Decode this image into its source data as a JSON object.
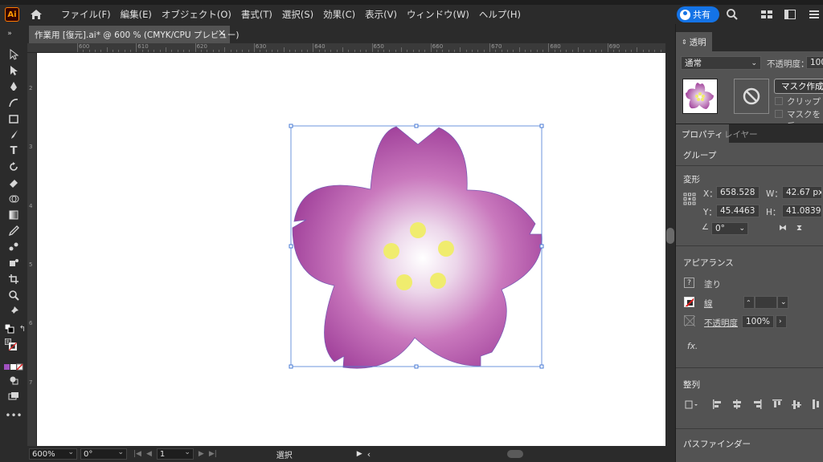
{
  "menu": {
    "app_logo": "Ai",
    "items": [
      "ファイル(F)",
      "編集(E)",
      "オブジェクト(O)",
      "書式(T)",
      "選択(S)",
      "効果(C)",
      "表示(V)",
      "ウィンドウ(W)",
      "ヘルプ(H)"
    ],
    "share_label": "共有"
  },
  "document": {
    "tab_title": "作業用 [復元].ai* @ 600 % (CMYK/CPU プレビュー)",
    "close": "×"
  },
  "ruler": {
    "h_ticks": [
      "600",
      "610",
      "620",
      "630",
      "640",
      "650",
      "660",
      "670",
      "680",
      "690"
    ],
    "v_ticks": [
      "2",
      "3",
      "4",
      "5",
      "6",
      "7"
    ]
  },
  "status": {
    "zoom": "600%",
    "rotation": "0°",
    "artboard": "1",
    "mode": "選択"
  },
  "transparency": {
    "panel_title": "透明",
    "blend_mode": "通常",
    "opacity_label": "不透明度：",
    "opacity_value": "100",
    "make_mask_label": "マスク作成",
    "clip_label": "クリップ",
    "invert_label": "マスクを反"
  },
  "properties": {
    "tab_properties": "プロパティ",
    "tab_layers": "レイヤー",
    "selection_type": "グループ",
    "transform_label": "変形",
    "x_label": "X：",
    "x_value": "658.528",
    "w_label": "W：",
    "w_value": "42.67 px",
    "y_label": "Y：",
    "y_value": "45.4463",
    "h_label": "H：",
    "h_value": "41.0839",
    "angle_value": "0°",
    "appearance_label": "アピアランス",
    "fill_label": "塗り",
    "stroke_label": "線",
    "opacity_label": "不透明度",
    "opacity_value": "100%",
    "fx_label": "fx.",
    "align_label": "整列",
    "pathfinder_label": "パスファインダー"
  },
  "colors": {
    "petal_edge": "#a8459c",
    "petal_center": "#ffffff",
    "stamen": "#f0ec6e",
    "selection": "#4a7bd6",
    "accent_blue": "#1473e6"
  }
}
